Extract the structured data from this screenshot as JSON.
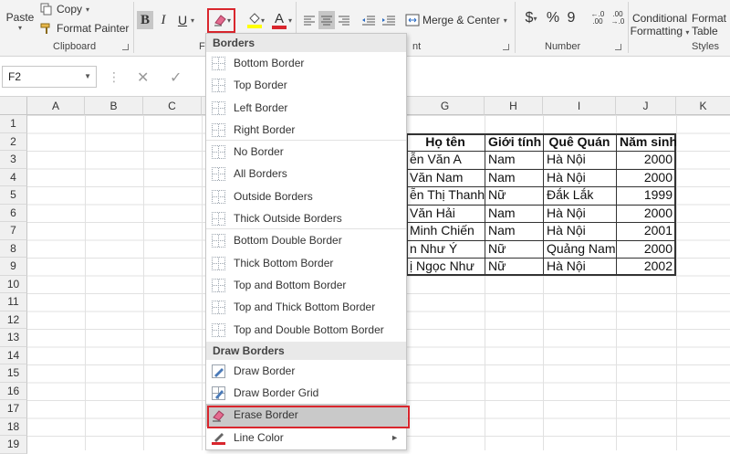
{
  "ribbon": {
    "clipboard": {
      "paste": "Paste",
      "copy": "Copy",
      "copy_caret": "▾",
      "format_painter": "Format Painter",
      "label": "Clipboard"
    },
    "font": {
      "bold": "B",
      "italic": "I",
      "underline": "U",
      "label": "F"
    },
    "alignment": {
      "label": "nt"
    },
    "merge_center": "Merge & Center",
    "number": {
      "currency": "$",
      "percent": "%",
      "comma": "9",
      "label": "Number"
    },
    "styles": {
      "conditional_1": "Conditional",
      "conditional_2": "Formatting",
      "format_table_1": "Format",
      "format_table_2": "Table",
      "label": "Styles"
    }
  },
  "formula_bar": {
    "cell_ref": "F2",
    "cancel": "✕",
    "enter": "✓"
  },
  "grid": {
    "columns": [
      "A",
      "B",
      "C",
      "G",
      "H",
      "I",
      "J",
      "K"
    ],
    "rows": [
      "1",
      "2",
      "3",
      "4",
      "5",
      "6",
      "7",
      "8",
      "9",
      "10",
      "11",
      "12",
      "13",
      "14",
      "15",
      "16",
      "17",
      "18",
      "19"
    ]
  },
  "table": {
    "headers": [
      "Họ tên",
      "Giới tính",
      "Quê Quán",
      "Năm sinh"
    ],
    "rows": [
      [
        "ễn Văn A",
        "Nam",
        "Hà Nội",
        "2000"
      ],
      [
        "Văn Nam",
        "Nam",
        "Hà Nội",
        "2000"
      ],
      [
        "ễn Thị Thanh",
        "Nữ",
        "Đắk Lắk",
        "1999"
      ],
      [
        "Văn Hải",
        "Nam",
        "Hà Nội",
        "2000"
      ],
      [
        "Minh Chiến",
        "Nam",
        "Hà Nội",
        "2001"
      ],
      [
        "n Như Ý",
        "Nữ",
        "Quảng Nam",
        "2000"
      ],
      [
        "ị Ngọc Như",
        "Nữ",
        "Hà Nội",
        "2002"
      ]
    ]
  },
  "menu": {
    "section_borders": "Borders",
    "borders": [
      "Bottom Border",
      "Top Border",
      "Left Border",
      "Right Border",
      "No Border",
      "All Borders",
      "Outside Borders",
      "Thick Outside Borders",
      "Bottom Double Border",
      "Thick Bottom Border",
      "Top and Bottom Border",
      "Top and Thick Bottom Border",
      "Top and Double Bottom Border"
    ],
    "section_draw": "Draw Borders",
    "draw": [
      "Draw Border",
      "Draw Border Grid",
      "Erase Border",
      "Line Color"
    ],
    "submenu_arrow": "►"
  },
  "colors": {
    "highlight_red": "#d9262d",
    "font_color_bar": "#d9262d",
    "fill_color_bar": "#ffff00",
    "selected_item": "#c9c9c9"
  },
  "icons": [
    "paste-icon",
    "copy-icon",
    "format-painter-icon",
    "eraser-icon",
    "fill-color-icon",
    "font-color-icon",
    "align-icon",
    "indent-icon",
    "merge-icon",
    "pencil-icon",
    "line-color-icon"
  ]
}
